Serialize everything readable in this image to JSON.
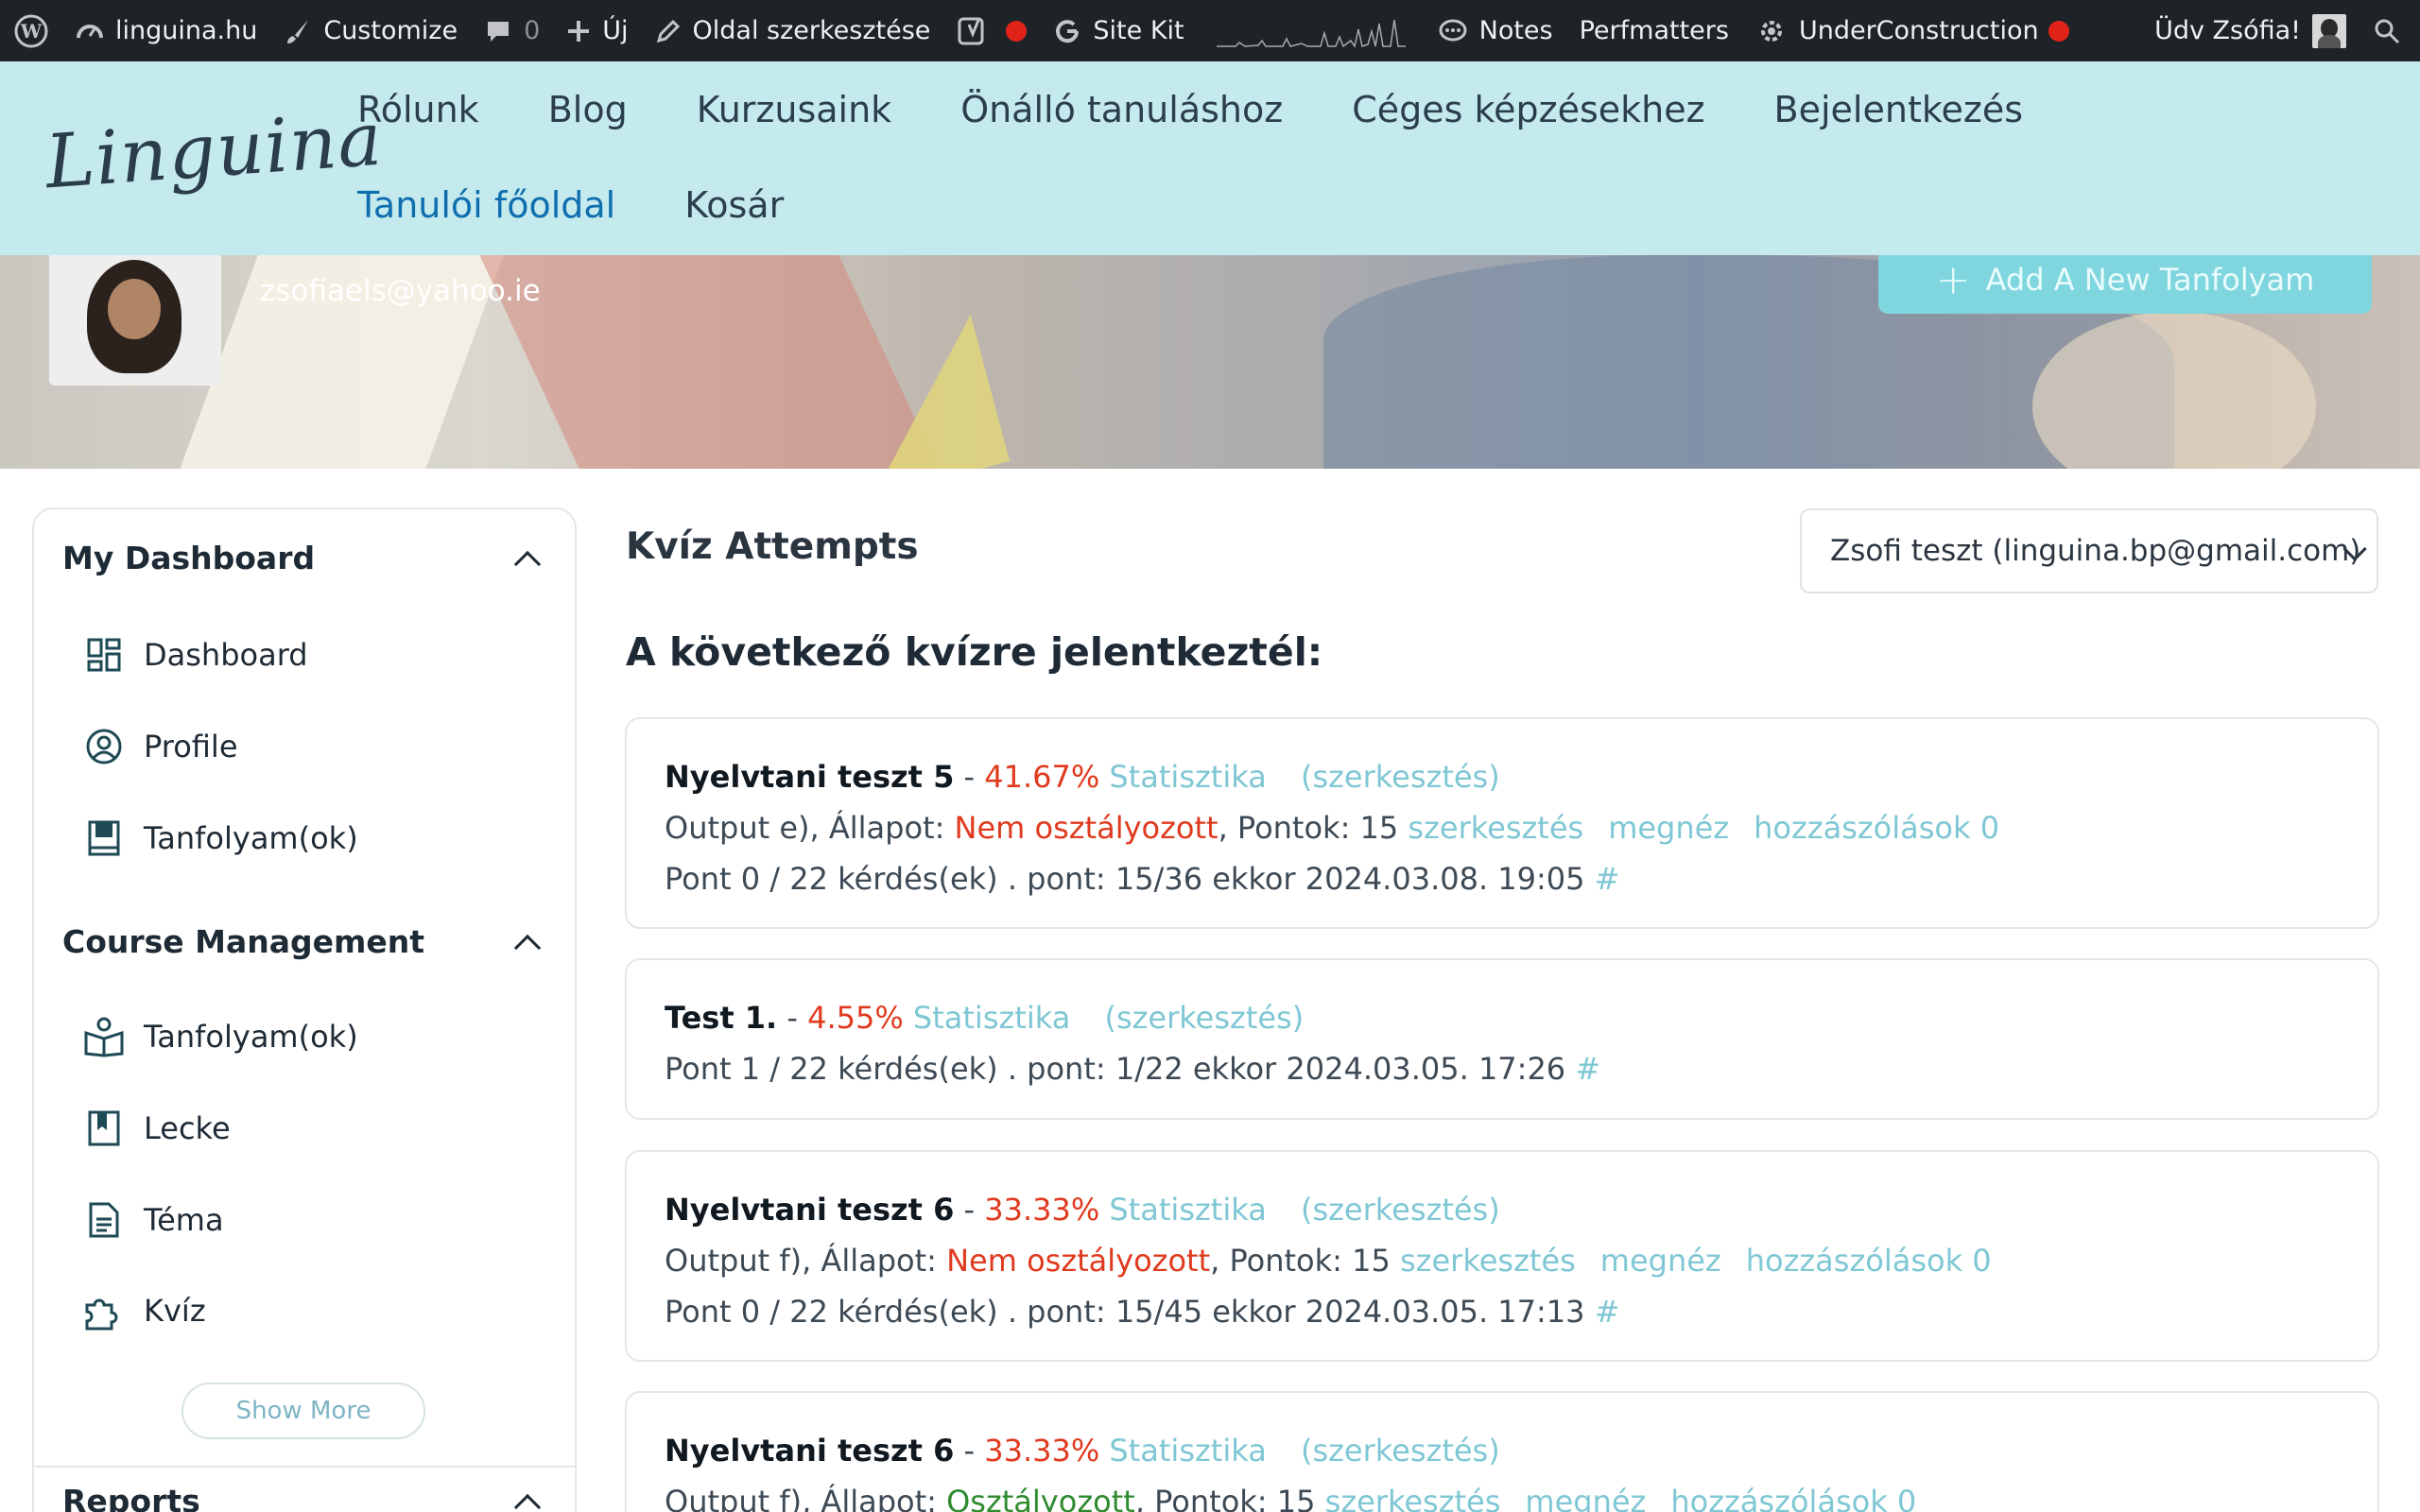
{
  "admin_bar": {
    "site": "linguina.hu",
    "customize": "Customize",
    "comments_count": "0",
    "new": "Új",
    "edit_page": "Oldal szerkesztése",
    "site_kit": "Site Kit",
    "notes": "Notes",
    "perfmatters": "Perfmatters",
    "under_construction": "UnderConstruction",
    "greeting": "Üdv Zsófia!"
  },
  "header": {
    "logo": "Linguina",
    "nav": [
      "Rólunk",
      "Blog",
      "Kurzusaink",
      "Önálló tanuláshoz",
      "Céges képzésekhez",
      "Bejelentkezés",
      "Tanulói főoldal",
      "Kosár"
    ]
  },
  "banner": {
    "email": "zsofiaels@yahoo.ie",
    "add_button": "Add A New Tanfolyam"
  },
  "sidebar": {
    "sections": [
      {
        "title": "My Dashboard",
        "items": [
          "Dashboard",
          "Profile",
          "Tanfolyam(ok)"
        ]
      },
      {
        "title": "Course Management",
        "items": [
          "Tanfolyam(ok)",
          "Lecke",
          "Téma",
          "Kvíz"
        ]
      },
      {
        "title": "Reports",
        "items": []
      }
    ],
    "show_more": "Show More"
  },
  "main": {
    "title": "Kvíz Attempts",
    "user_select": "Zsofi teszt (linguina.bp@gmail.com)",
    "subtitle": "A következő kvízre jelentkeztél:",
    "attempts": [
      {
        "quiz": "Nyelvtani teszt 5",
        "sep": " - ",
        "percent": "41.67%",
        "stats": "Statisztika",
        "edit": "(szerkesztés)",
        "output": "Output e), Állapot: ",
        "status": "Nem osztályozott",
        "points": ", Pontok: 15 ",
        "edit_link": "szerkesztés",
        "view_link": "megnéz",
        "comments_link": "hozzászólások 0",
        "detail": "Pont 0 / 22 kérdés(ek) . pont: 15/36 ekkor 2024.03.08. 19:05 ",
        "hash": "#"
      },
      {
        "quiz": "Test 1.",
        "sep": " - ",
        "percent": "4.55%",
        "stats": "Statisztika",
        "edit": "(szerkesztés)",
        "detail": "Pont 1 / 22 kérdés(ek) . pont: 1/22 ekkor 2024.03.05. 17:26 ",
        "hash": "#"
      },
      {
        "quiz": "Nyelvtani teszt 6",
        "sep": " - ",
        "percent": "33.33%",
        "stats": "Statisztika",
        "edit": "(szerkesztés)",
        "output": "Output f), Állapot: ",
        "status": "Nem osztályozott",
        "points": ", Pontok: 15 ",
        "edit_link": "szerkesztés",
        "view_link": "megnéz",
        "comments_link": "hozzászólások 0",
        "detail": "Pont 0 / 22 kérdés(ek) . pont: 15/45 ekkor 2024.03.05. 17:13 ",
        "hash": "#"
      },
      {
        "quiz": "Nyelvtani teszt 6",
        "sep": " - ",
        "percent": "33.33%",
        "stats": "Statisztika",
        "edit": "(szerkesztés)",
        "output": "Output f), Állapot: ",
        "status": "Osztályozott",
        "points": ", Pontok: 15 ",
        "edit_link": "szerkesztés",
        "view_link": "megnéz",
        "comments_link": "hozzászólások 0"
      }
    ]
  },
  "colors": {
    "admin_bg": "#1d2327",
    "header_bg": "#c5eaee",
    "nav_active": "#0f6fae",
    "accent_button": "#7fd6de",
    "link": "#7fc7d4",
    "danger": "#e03a1e",
    "success": "#2e8b2e"
  }
}
